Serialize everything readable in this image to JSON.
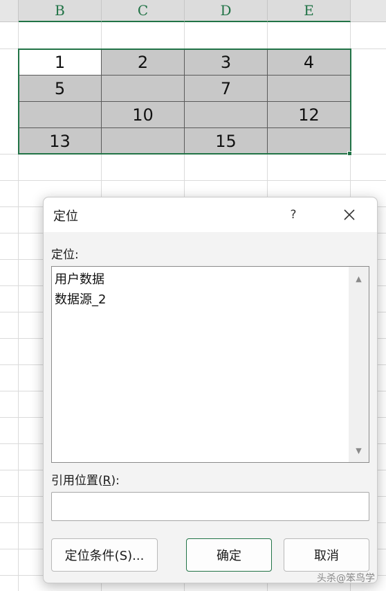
{
  "spreadsheet": {
    "columns": [
      "B",
      "C",
      "D",
      "E"
    ],
    "rows": [
      [
        "1",
        "2",
        "3",
        "4"
      ],
      [
        "5",
        "",
        "7",
        ""
      ],
      [
        "",
        "10",
        "",
        "12"
      ],
      [
        "13",
        "",
        "15",
        ""
      ]
    ],
    "active_cell": "B2",
    "colors": {
      "header_accent": "#217346",
      "selected_fill": "#c8c8c8"
    }
  },
  "dialog": {
    "title": "定位",
    "help_label": "?",
    "close_icon": "close-icon",
    "goto_label": "定位:",
    "list_items": [
      "用户数据",
      "数据源_2"
    ],
    "reference_label_prefix": "引用位置(",
    "reference_label_key": "R",
    "reference_label_suffix": "):",
    "reference_value": "",
    "buttons": {
      "special": "定位条件(S)...",
      "ok": "确定",
      "cancel": "取消"
    }
  },
  "watermark": "头杀@笨鸟学"
}
